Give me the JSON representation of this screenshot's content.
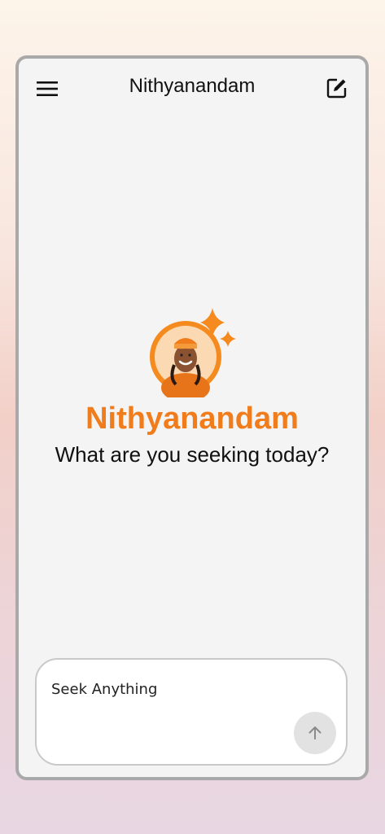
{
  "app": {
    "title": "Nithyanandam"
  },
  "hero": {
    "brand_name": "Nithyanandam",
    "tagline": "What are you seeking today?"
  },
  "composer": {
    "placeholder": "Seek Anything",
    "value": ""
  },
  "icons": {
    "menu": "hamburger-menu-icon",
    "new_chat": "edit-note-icon",
    "send": "arrow-up-icon",
    "logo_sparkles": "sparkle-icon"
  },
  "colors": {
    "brand_orange": "#f07c1c",
    "phone_bg": "#f4f4f4",
    "send_btn_bg": "#e2e2e2"
  }
}
